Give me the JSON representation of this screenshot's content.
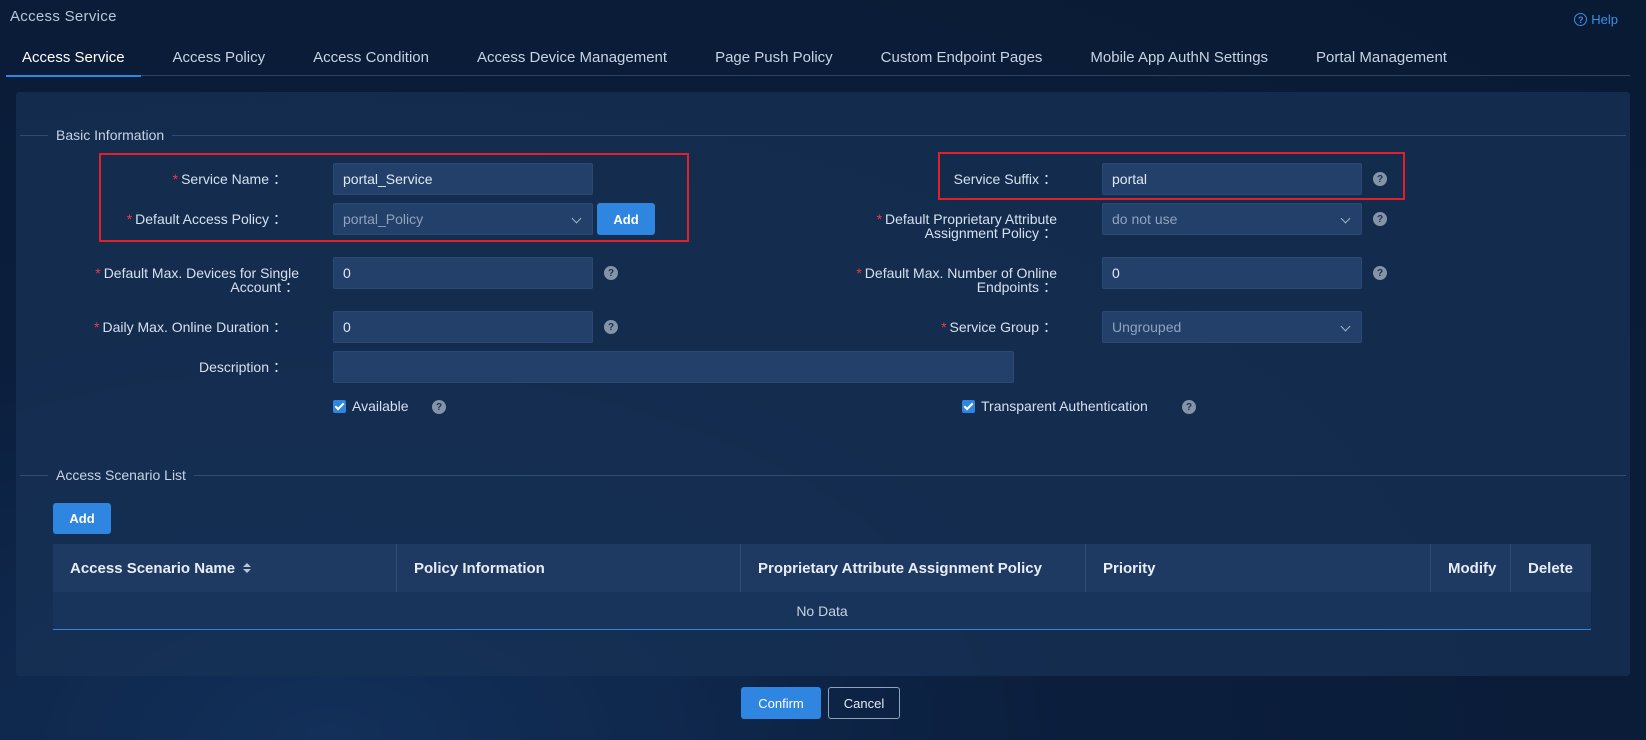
{
  "app_title": "Access Service",
  "help_label": "Help",
  "tabs": [
    {
      "label": "Access Service"
    },
    {
      "label": "Access Policy"
    },
    {
      "label": "Access Condition"
    },
    {
      "label": "Access Device Management"
    },
    {
      "label": "Page Push Policy"
    },
    {
      "label": "Custom Endpoint Pages"
    },
    {
      "label": "Mobile App AuthN Settings"
    },
    {
      "label": "Portal Management"
    }
  ],
  "basic": {
    "section_title": "Basic Information",
    "service_name": {
      "label": "Service Name",
      "value": "portal_Service"
    },
    "default_access_policy": {
      "label": "Default Access Policy",
      "value": "portal_Policy",
      "add_label": "Add"
    },
    "max_devices": {
      "label_1": "Default Max. Devices for Single",
      "label_2": "Account",
      "value": "0"
    },
    "daily_max_duration": {
      "label": "Daily Max. Online Duration",
      "value": "0"
    },
    "description": {
      "label": "Description",
      "value": ""
    },
    "available": {
      "label": "Available"
    },
    "service_suffix": {
      "label": "Service Suffix",
      "value": "portal"
    },
    "proprietary_policy": {
      "label_1": "Default Proprietary Attribute",
      "label_2": "Assignment Policy",
      "value": "do not use"
    },
    "max_online": {
      "label_1": "Default Max. Number of Online",
      "label_2": "Endpoints",
      "value": "0"
    },
    "service_group": {
      "label": "Service Group",
      "value": "Ungrouped"
    },
    "transparent_auth": {
      "label": "Transparent Authentication"
    },
    "colon": "："
  },
  "scenario": {
    "section_title": "Access Scenario List",
    "add_label": "Add",
    "columns": [
      "Access Scenario Name",
      "Policy Information",
      "Proprietary Attribute Assignment Policy",
      "Priority",
      "Modify",
      "Delete"
    ],
    "empty_text": "No Data"
  },
  "footer": {
    "confirm_label": "Confirm",
    "cancel_label": "Cancel"
  },
  "colors": {
    "accent": "#2f86e0",
    "required": "#ef3b4b",
    "highlight_box": "#e0202a"
  }
}
